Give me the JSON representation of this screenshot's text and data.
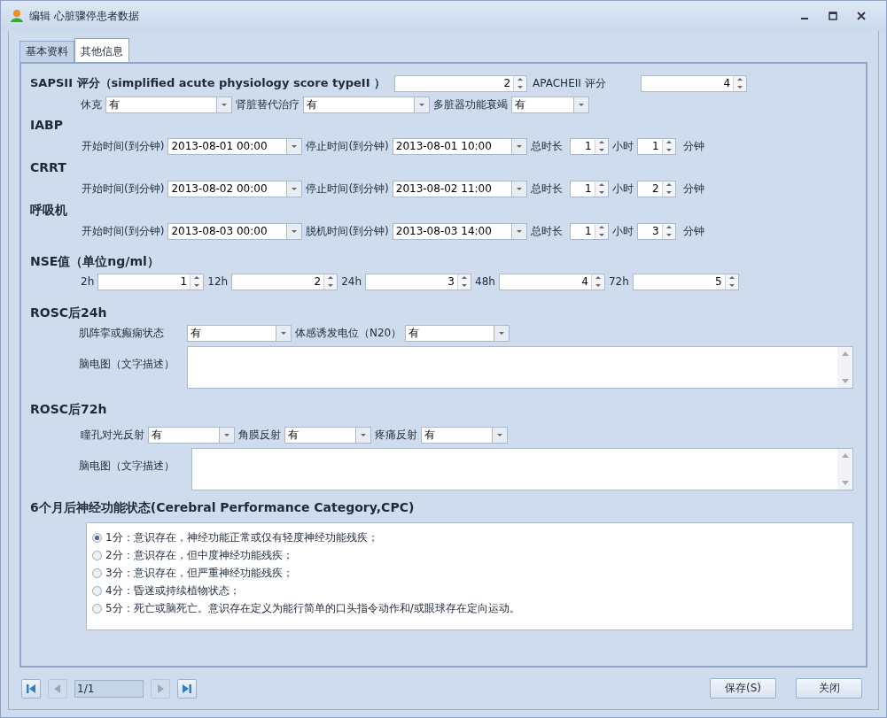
{
  "window": {
    "title": "编辑 心脏骤停患者数据"
  },
  "tabs": [
    {
      "label": "基本资料",
      "selected": false
    },
    {
      "label": "其他信息",
      "selected": true
    }
  ],
  "scores": [
    {
      "label": "SAPSII 评分（simplified acute physiology score typeII ）",
      "value": "2"
    },
    {
      "label": "APACHEII 评分",
      "value": "4"
    }
  ],
  "organ_support": [
    {
      "label": "休克",
      "value": "有"
    },
    {
      "label": "肾脏替代治疗",
      "value": "有"
    },
    {
      "label": "多脏器功能衰竭",
      "value": "有"
    }
  ],
  "procedures": [
    {
      "title": "IABP",
      "start_label": "开始时间(到分钟)",
      "start": "2013-08-01 00:00",
      "stop_label": "停止时间(到分钟)",
      "stop": "2013-08-01 10:00",
      "total_label": "总时长",
      "hours": "1",
      "hours_unit": "小时",
      "minutes": "1",
      "minutes_unit": "分钟"
    },
    {
      "title": "CRRT",
      "start_label": "开始时间(到分钟)",
      "start": "2013-08-02 00:00",
      "stop_label": "停止时间(到分钟)",
      "stop": "2013-08-02 11:00",
      "total_label": "总时长",
      "hours": "1",
      "hours_unit": "小时",
      "minutes": "2",
      "minutes_unit": "分钟"
    },
    {
      "title": "呼吸机",
      "start_label": "开始时间(到分钟)",
      "start": "2013-08-03 00:00",
      "stop_label": "脱机时间(到分钟)",
      "stop": "2013-08-03 14:00",
      "total_label": "总时长",
      "hours": "1",
      "hours_unit": "小时",
      "minutes": "3",
      "minutes_unit": "分钟"
    }
  ],
  "nse": {
    "title": "NSE值（单位ng/ml）",
    "items": [
      {
        "label": "2h",
        "value": "1"
      },
      {
        "label": "12h",
        "value": "2"
      },
      {
        "label": "24h",
        "value": "3"
      },
      {
        "label": "48h",
        "value": "4"
      },
      {
        "label": "72h",
        "value": "5"
      }
    ]
  },
  "rosc_24h": {
    "title": "ROSC后24h",
    "combos": [
      {
        "label": "肌阵挛或癫痫状态",
        "value": "有"
      },
      {
        "label": "体感诱发电位（N20）",
        "value": "有"
      }
    ],
    "eeg_label": "脑电图（文字描述）"
  },
  "rosc_72h": {
    "title": "ROSC后72h",
    "combos": [
      {
        "label": "瞳孔对光反射",
        "value": "有"
      },
      {
        "label": "角膜反射",
        "value": "有"
      },
      {
        "label": "疼痛反射",
        "value": "有"
      }
    ],
    "eeg_label": "脑电图（文字描述）"
  },
  "cpc": {
    "title": "6个月后神经功能状态(Cerebral Performance Category,CPC)",
    "options": [
      {
        "label": "1分：意识存在，神经功能正常或仅有轻度神经功能残疾；",
        "selected": true
      },
      {
        "label": "2分：意识存在，但中度神经功能残疾；",
        "selected": false
      },
      {
        "label": "3分：意识存在，但严重神经功能残疾；",
        "selected": false
      },
      {
        "label": "4分：昏迷或持续植物状态；",
        "selected": false
      },
      {
        "label": "5分：死亡或脑死亡。意识存在定义为能行简单的口头指令动作和/或眼球存在定向运动。",
        "selected": false
      }
    ]
  },
  "pager": {
    "page": "1/1",
    "nav": [
      {
        "kind": "first",
        "disabled": false
      },
      {
        "kind": "prev",
        "disabled": true
      },
      {
        "kind": "next",
        "disabled": true
      },
      {
        "kind": "last",
        "disabled": false
      }
    ]
  },
  "buttons": [
    "保存(S)",
    "关闭"
  ]
}
